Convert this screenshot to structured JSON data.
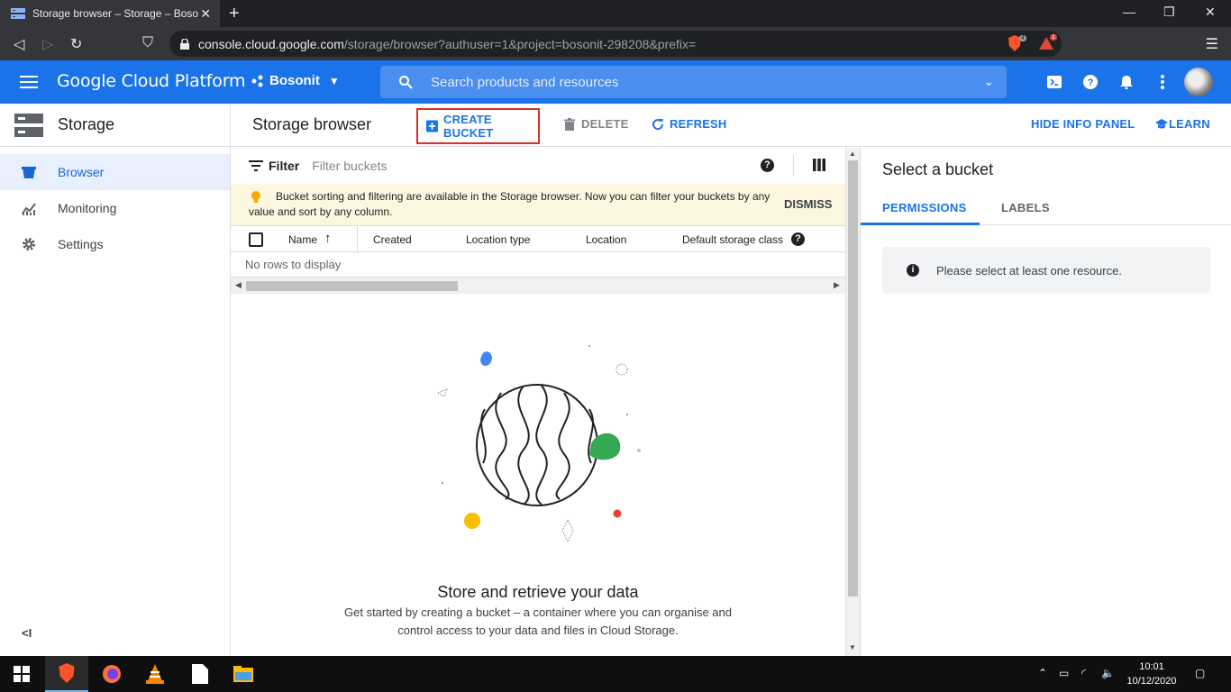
{
  "browser": {
    "tab_title": "Storage browser – Storage – Bosonit",
    "url_host": "console.cloud.google.com",
    "url_path": "/storage/browser?authuser=1&project=bosonit-298208&prefix=",
    "brave_badge": "4",
    "rewards_badge": "1"
  },
  "header": {
    "title": "Google Cloud Platform",
    "project": "Bosonit",
    "search_placeholder": "Search products and resources"
  },
  "leftnav": {
    "product": "Storage",
    "items": [
      {
        "label": "Browser",
        "icon": "bucket-icon",
        "active": true
      },
      {
        "label": "Monitoring",
        "icon": "chart-icon",
        "active": false
      },
      {
        "label": "Settings",
        "icon": "gear-icon",
        "active": false
      }
    ],
    "collapse_label": "<I"
  },
  "toolbar": {
    "page_title": "Storage browser",
    "create": "CREATE BUCKET",
    "delete": "DELETE",
    "refresh": "REFRESH",
    "hide_info": "HIDE INFO PANEL",
    "learn": "LEARN"
  },
  "filter": {
    "label": "Filter",
    "placeholder": "Filter buckets"
  },
  "notice": {
    "text": "Bucket sorting and filtering are available in the Storage browser. Now you can filter your buckets by any value and sort by any column.",
    "dismiss": "DISMISS"
  },
  "table": {
    "columns": [
      "Name",
      "Created",
      "Location type",
      "Location",
      "Default storage class"
    ],
    "empty": "No rows to display"
  },
  "empty_state": {
    "title": "Store and retrieve your data",
    "description": "Get started by creating a bucket – a container where you can organise and control access to your data and files in Cloud Storage."
  },
  "info_panel": {
    "title": "Select a bucket",
    "tabs": [
      "PERMISSIONS",
      "LABELS"
    ],
    "message": "Please select at least one resource."
  },
  "taskbar": {
    "time": "10:01",
    "date": "10/12/2020"
  },
  "colors": {
    "primary": "#1a73e8",
    "highlight_border": "#d93025"
  }
}
